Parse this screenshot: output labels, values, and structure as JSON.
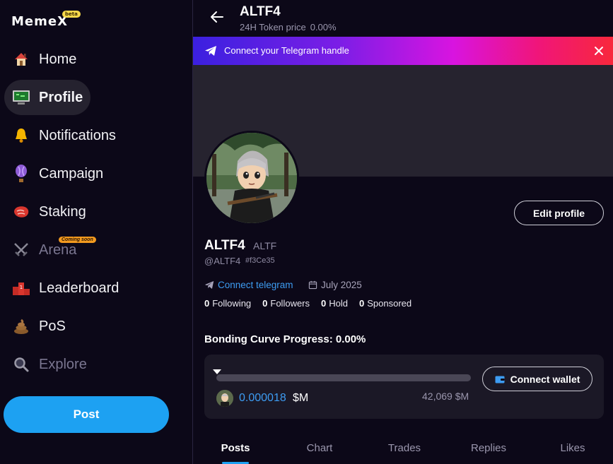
{
  "app": {
    "logo": "MemeX",
    "logo_badge": "beta"
  },
  "sidebar": {
    "items": [
      {
        "label": "Home",
        "icon": "house-icon"
      },
      {
        "label": "Profile",
        "icon": "computer-icon"
      },
      {
        "label": "Notifications",
        "icon": "bell-icon"
      },
      {
        "label": "Campaign",
        "icon": "hot-air-balloon-icon"
      },
      {
        "label": "Staking",
        "icon": "meat-icon"
      },
      {
        "label": "Arena",
        "icon": "crossed-swords-icon",
        "badge": "Coming soon"
      },
      {
        "label": "Leaderboard",
        "icon": "podium-icon"
      },
      {
        "label": "PoS",
        "icon": "poop-icon"
      },
      {
        "label": "Explore",
        "icon": "magnifier-icon"
      }
    ],
    "post_button": "Post",
    "active": "Profile"
  },
  "header": {
    "title": "ALTF4",
    "price_label": "24H Token price",
    "price_change": "0.00%"
  },
  "telegram_banner": {
    "text": "Connect your Telegram handle"
  },
  "profile": {
    "name": "ALTF4",
    "ticker": "ALTF",
    "handle": "@ALTF4",
    "handle_id": "#f3Ce35",
    "connect_telegram": "Connect telegram",
    "joined": "July 2025",
    "edit_button": "Edit profile",
    "stats": [
      {
        "value": "0",
        "label": "Following"
      },
      {
        "value": "0",
        "label": "Followers"
      },
      {
        "value": "0",
        "label": "Hold"
      },
      {
        "value": "0",
        "label": "Sponsored"
      }
    ]
  },
  "bonding": {
    "title": "Bonding Curve Progress: 0.00%",
    "progress": 0.0,
    "price": "0.000018",
    "price_unit": "$M",
    "market_cap": "42,069 $M",
    "connect_wallet": "Connect wallet"
  },
  "tabs": [
    "Posts",
    "Chart",
    "Trades",
    "Replies",
    "Likes"
  ],
  "colors": {
    "accent": "#1da1f2",
    "link": "#3d9cf2",
    "background": "#0c0818"
  }
}
